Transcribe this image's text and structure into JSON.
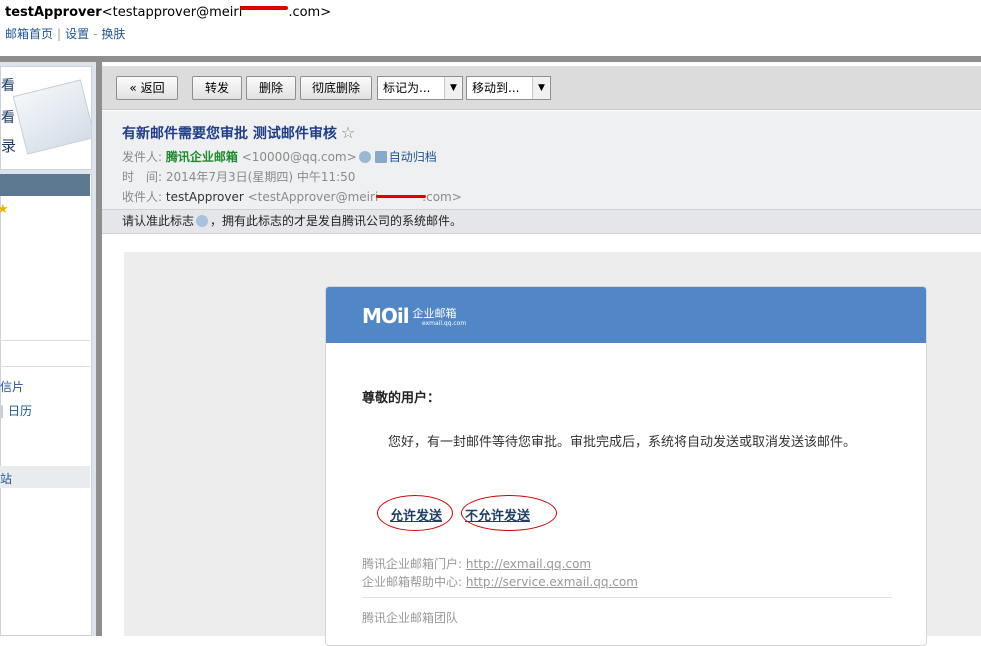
{
  "header": {
    "username": "testApprover",
    "email_prefix": "<testapprover@meiri",
    "email_suffix": ".com>",
    "links": [
      "邮箱首页",
      "设置",
      "换肤"
    ]
  },
  "sidebar": {
    "top_items": [
      "看",
      "看",
      "录"
    ],
    "items": [
      "信片",
      "日历",
      "站"
    ]
  },
  "toolbar": {
    "back": "« 返回",
    "forward": "转发",
    "delete": "删除",
    "perm_delete": "彻底删除",
    "mark_as": "标记为...",
    "move_to": "移动到..."
  },
  "mail": {
    "subject": "有新邮件需要您审批 测试邮件审核",
    "from_label": "发件人:",
    "from_name": "腾讯企业邮箱",
    "from_addr": "<10000@qq.com>",
    "auto_archive": "自动归档",
    "time_label": "时　间:",
    "time": "2014年7月3日(星期四) 中午11:50",
    "to_label": "收件人:",
    "to_name": "testApprover",
    "to_addr_prefix": "<testApprover@meiri",
    "to_addr_suffix": ".com>",
    "notice_prefix": "请认准此标志",
    "notice_suffix": "，拥有此标志的才是发自腾讯公司的系统邮件。"
  },
  "card": {
    "logo": "MOil",
    "logo_cn": "企业邮箱",
    "logo_domain": "exmail.qq.com",
    "greeting": "尊敬的用户：",
    "message": "您好，有一封邮件等待您审批。审批完成后，系统将自动发送或取消发送该邮件。",
    "allow": "允许发送",
    "deny": "不允许发送",
    "portal_label": "腾讯企业邮箱门户:",
    "portal_url": "http://exmail.qq.com",
    "help_label": "企业邮箱帮助中心:",
    "help_url": "http://service.exmail.qq.com",
    "team": "腾讯企业邮箱团队"
  },
  "colors": {
    "card_header": "#5187c6",
    "sender_green": "#1e8a2c",
    "subject_blue": "#1f3d88",
    "annotation_red": "#d40000"
  }
}
